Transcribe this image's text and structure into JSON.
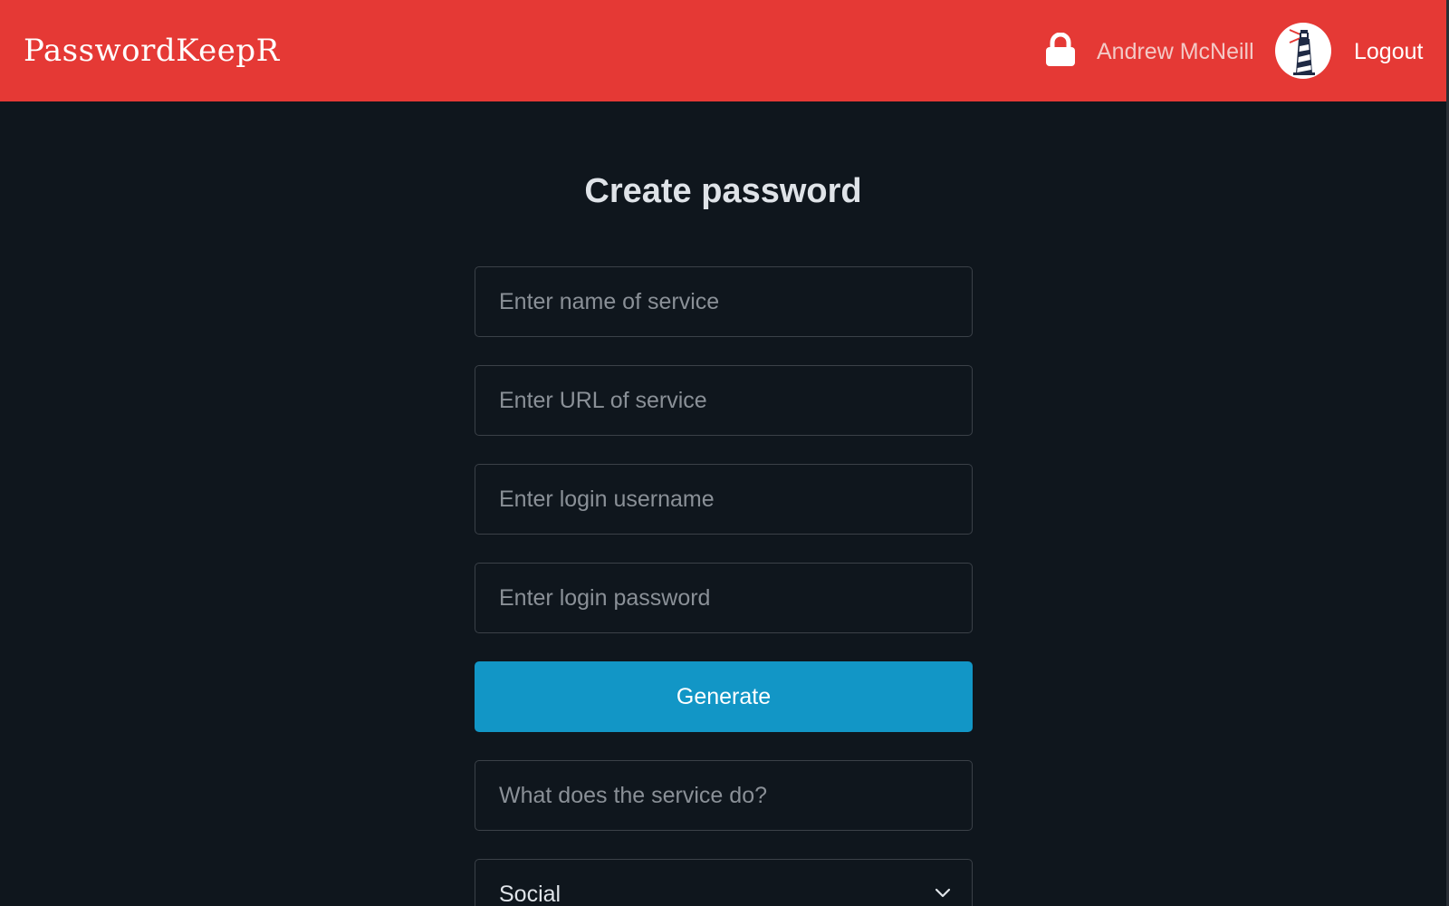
{
  "navbar": {
    "brand": "PasswordKeepR",
    "user_name": "Andrew McNeill",
    "logout_label": "Logout",
    "lock_icon": "lock-icon",
    "avatar_icon": "lighthouse-avatar",
    "color": "#e53935"
  },
  "main": {
    "title": "Create password",
    "fields": {
      "service_name": {
        "placeholder": "Enter name of service",
        "value": ""
      },
      "service_url": {
        "placeholder": "Enter URL of service",
        "value": ""
      },
      "login_username": {
        "placeholder": "Enter login username",
        "value": ""
      },
      "login_password": {
        "placeholder": "Enter login password",
        "value": ""
      },
      "service_description": {
        "placeholder": "What does the service do?",
        "value": ""
      }
    },
    "generate_label": "Generate",
    "generate_color": "#1296c6",
    "category": {
      "selected": "Social",
      "options": [
        "Social"
      ]
    }
  },
  "theme": {
    "background": "#0f161d",
    "input_border": "#3b4148"
  }
}
